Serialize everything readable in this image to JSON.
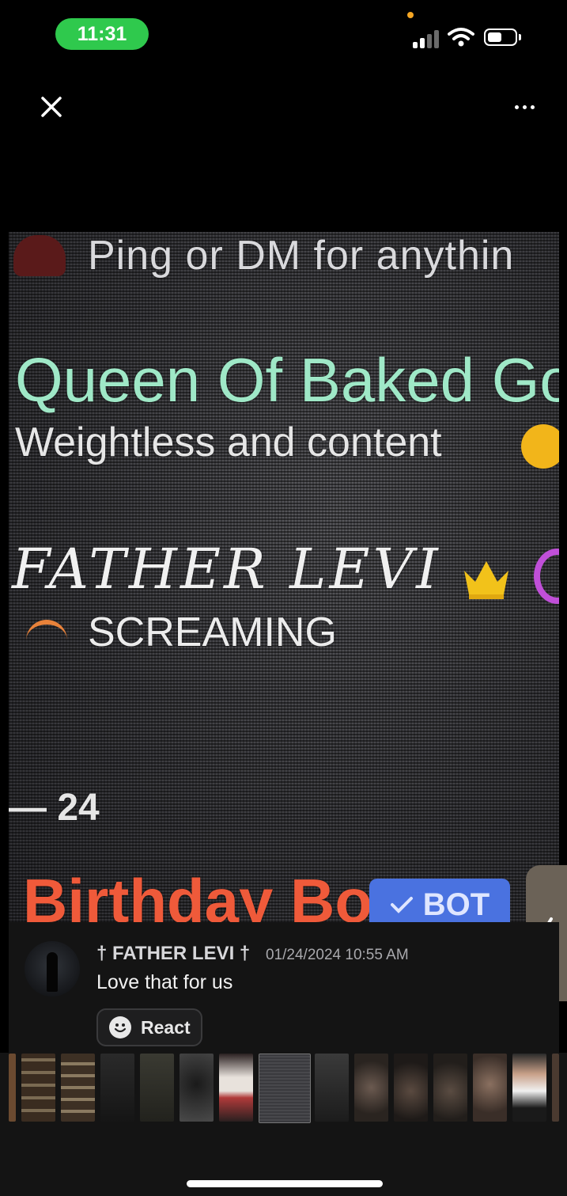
{
  "status_bar": {
    "time": "11:31"
  },
  "toolbar": {
    "close_icon": "close-icon",
    "more_icon": "more-horizontal-icon"
  },
  "photo": {
    "line1": "Ping or DM for anythin",
    "line2": "Queen Of Baked Go",
    "line3": "Weightless and content",
    "line4": "FATHER LEVI",
    "line5": "SCREAMING",
    "line6": "— 24",
    "line7": "Birthday Bot",
    "bot_badge": "BOT"
  },
  "message": {
    "author": "† FATHER LEVI †",
    "timestamp": "01/24/2024 10:55 AM",
    "text": "Love that for us",
    "react_label": "React"
  },
  "colors": {
    "time_pill": "#2fc94d",
    "bot_badge": "#4a72e0",
    "birthday": "#ef5a3a",
    "queen": "#9fe8c7"
  }
}
